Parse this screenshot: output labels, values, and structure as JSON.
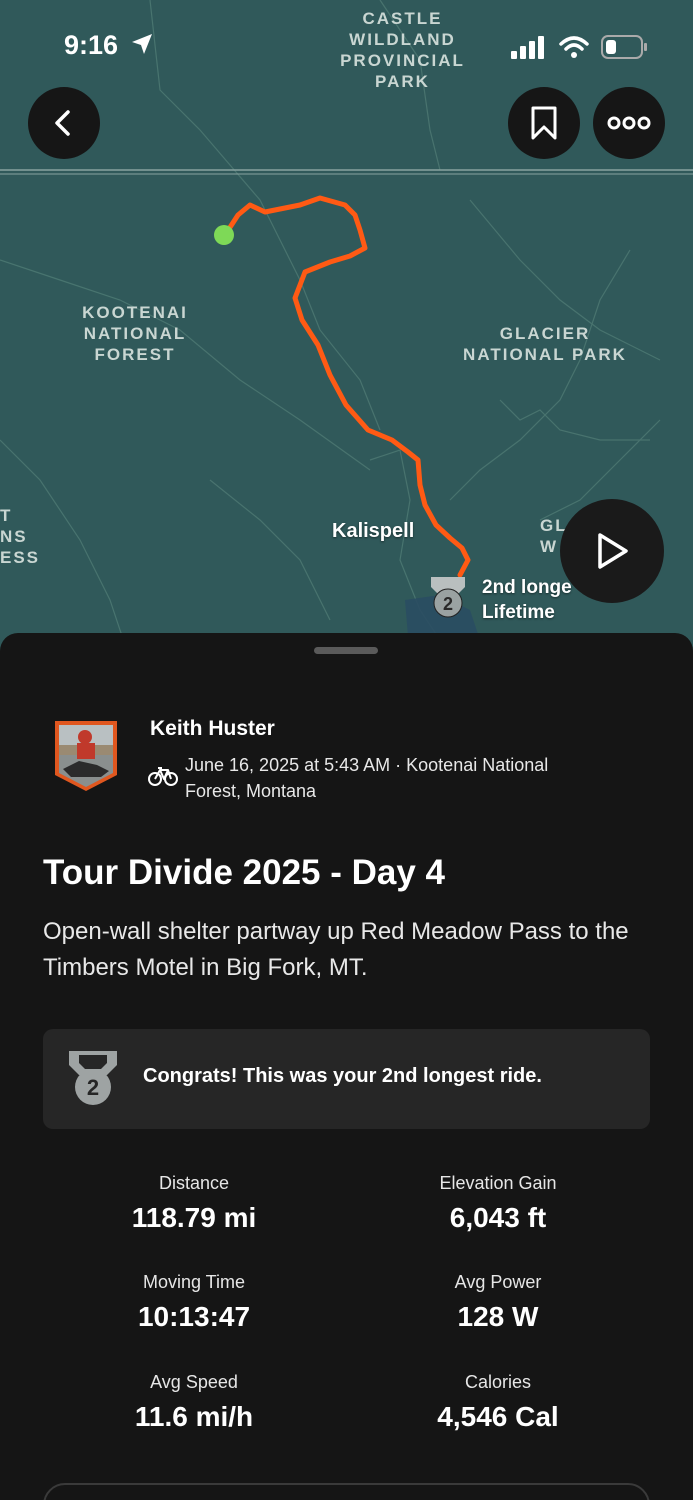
{
  "status_bar": {
    "time": "9:16"
  },
  "map": {
    "labels": {
      "castle": "CASTLE\nWILDLAND\nPROVINCIAL\nPARK",
      "kootenai": "KOOTENAI\nNATIONAL\nFOREST",
      "glacier": "GLACIER\nNATIONAL PARK",
      "left_edge": "T\nNS\nESS",
      "glacier_partial": "GL        R\nW          S"
    },
    "city": "Kalispell",
    "badge_text": "2nd longe\nLifetime",
    "route_color": "#ff5a14",
    "start_color": "#7ed957"
  },
  "buttons": {
    "back_icon": "chevron-left-icon",
    "bookmark_icon": "bookmark-icon",
    "more_icon": "more-icon",
    "play_icon": "play-icon"
  },
  "activity": {
    "athlete_name": "Keith Huster",
    "date_location": "June 16, 2025 at 5:43 AM · Kootenai National Forest, Montana",
    "title": "Tour Divide 2025 - Day 4",
    "description": "Open-wall shelter partway up Red Meadow Pass to the Timbers Motel in Big Fork, MT.",
    "achievement": "Congrats! This was your 2nd longest ride.",
    "achievement_rank": "2"
  },
  "stats": [
    {
      "label": "Distance",
      "value": "118.79 mi"
    },
    {
      "label": "Elevation Gain",
      "value": "6,043 ft"
    },
    {
      "label": "Moving Time",
      "value": "10:13:47"
    },
    {
      "label": "Avg Power",
      "value": "128 W"
    },
    {
      "label": "Avg Speed",
      "value": "11.6 mi/h"
    },
    {
      "label": "Calories",
      "value": "4,546 Cal"
    }
  ]
}
